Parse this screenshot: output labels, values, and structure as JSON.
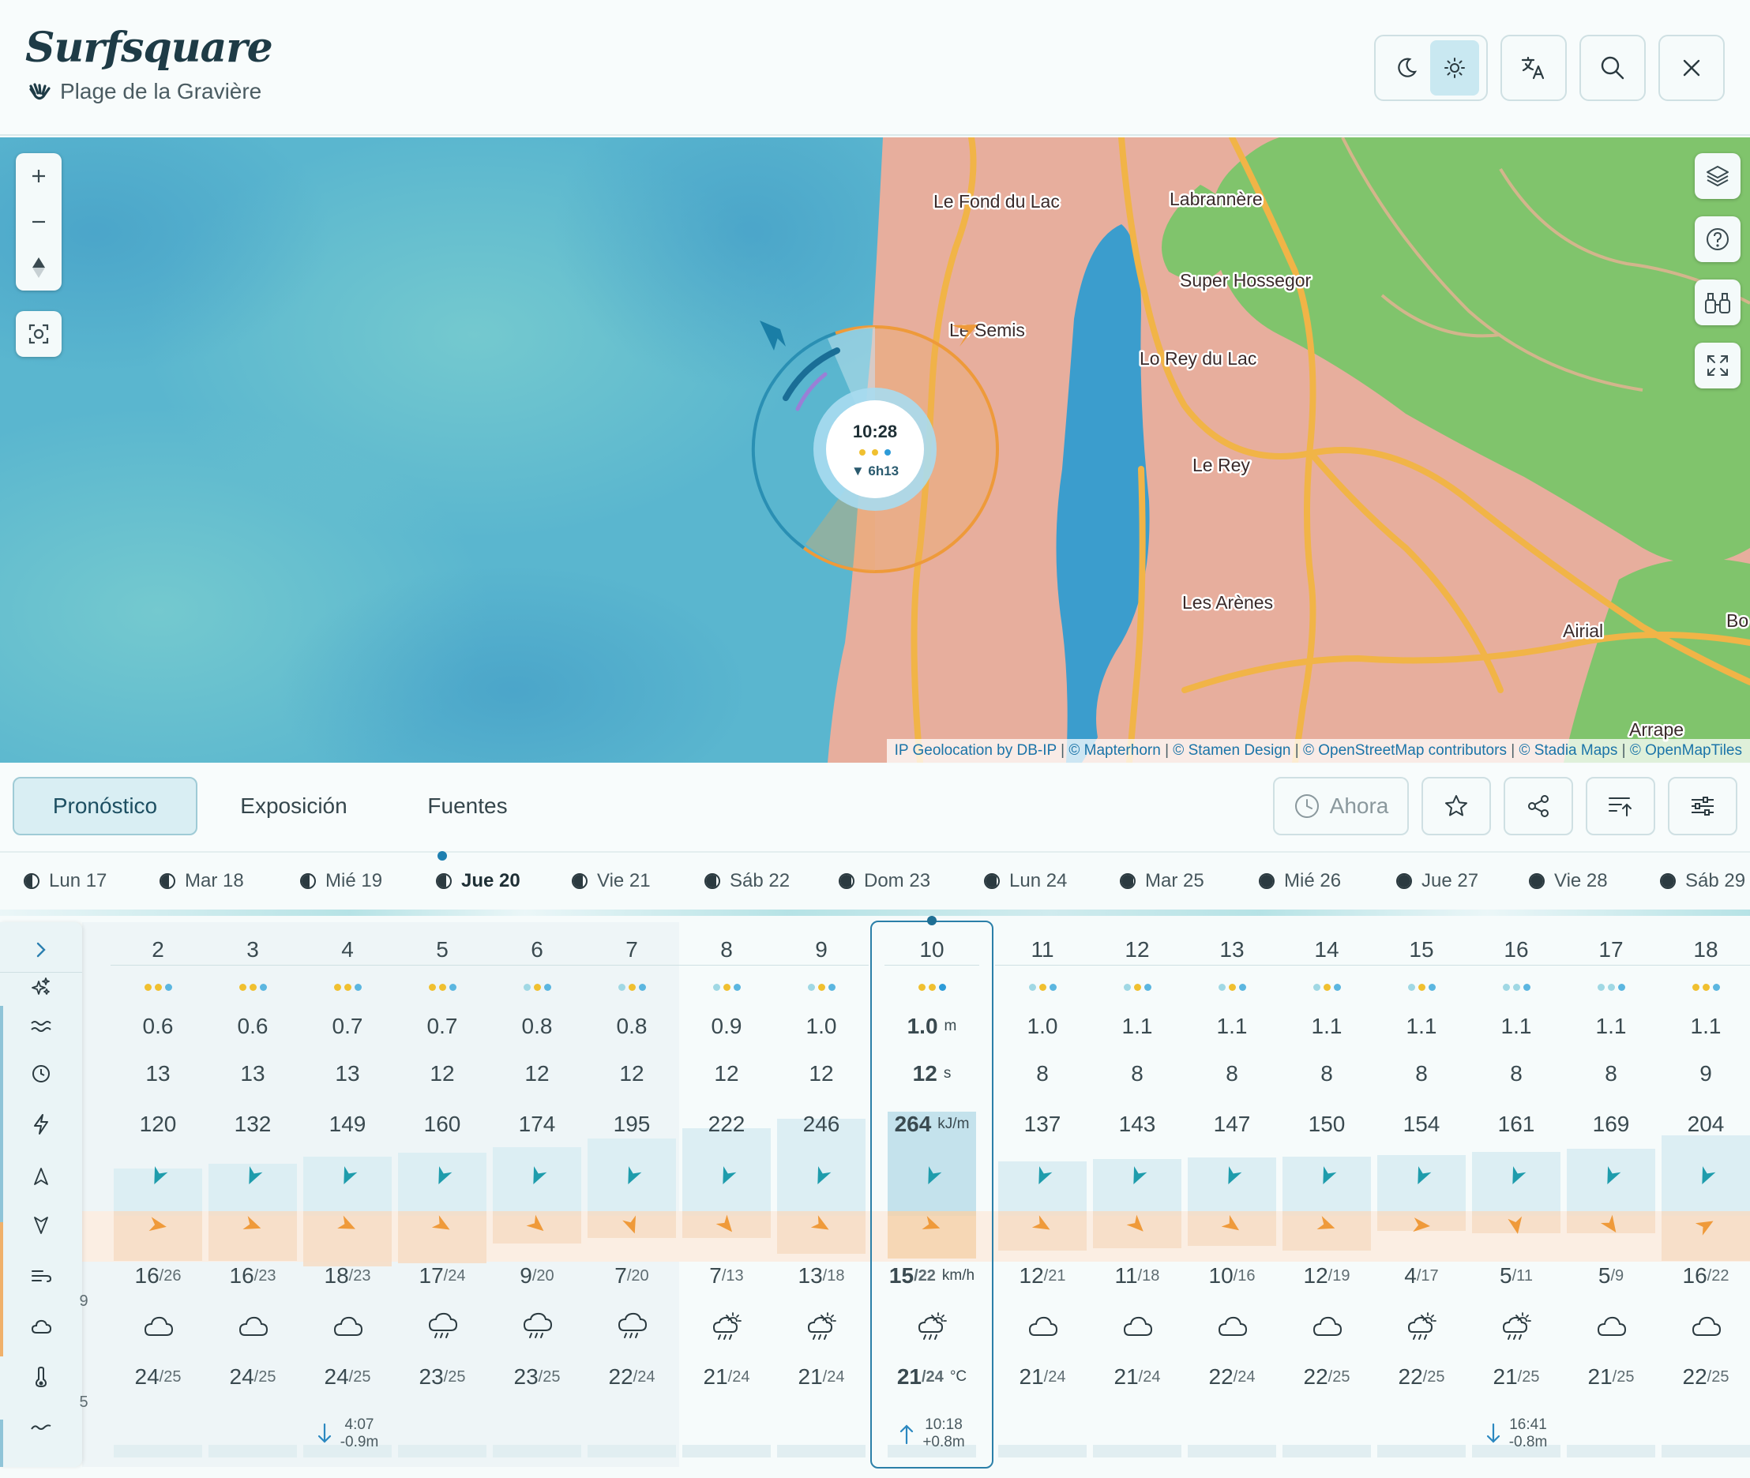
{
  "app": {
    "title": "Surfsquare",
    "place": "Plage de la Gravière"
  },
  "header": {
    "icons": [
      "moon-icon",
      "sun-icon",
      "translate-icon",
      "search-icon",
      "close-icon"
    ]
  },
  "map": {
    "labels": {
      "fond": "Le Fond du Lac",
      "labrannere": "Labrannère",
      "hossegor": "Super Hossegor",
      "semis": "Le Semis",
      "reylac": "Lo Rey du Lac",
      "rey": "Le Rey",
      "arenes": "Les Arènes",
      "airial": "Airial",
      "arrape": "Arrape",
      "bo": "Bo"
    },
    "marker": {
      "time": "10:28",
      "tide": "▼ 6h13"
    },
    "attribution": {
      "a": "IP Geolocation by DB-IP",
      "b": "© Mapterhorn",
      "c": "© Stamen Design",
      "d": "© OpenStreetMap contributors",
      "e": "© Stadia Maps",
      "f": "© OpenMapTiles",
      "sep": "|"
    },
    "colors": {
      "sea": "#5bb9d1",
      "land": "#e6ad9c",
      "forest": "#7cc26a",
      "road": "#f0b347",
      "lake": "#3c9ccf"
    }
  },
  "tabs": {
    "forecast": "Pronóstico",
    "exposure": "Exposición",
    "sources": "Fuentes",
    "now": "Ahora"
  },
  "days": [
    {
      "label": "Lun 17",
      "moon": 0.55
    },
    {
      "label": "Mar 18",
      "moon": 0.6
    },
    {
      "label": "Mié 19",
      "moon": 0.65
    },
    {
      "label": "Jue 20",
      "moon": 0.7,
      "selected": true
    },
    {
      "label": "Vie 21",
      "moon": 0.75
    },
    {
      "label": "Sáb 22",
      "moon": 0.8
    },
    {
      "label": "Dom 23",
      "moon": 0.85
    },
    {
      "label": "Lun 24",
      "moon": 0.9
    },
    {
      "label": "Mar 25",
      "moon": 0.95
    },
    {
      "label": "Mié 26",
      "moon": 0.97
    },
    {
      "label": "Jue 27",
      "moon": 1
    },
    {
      "label": "Vie 28",
      "moon": 1
    },
    {
      "label": "Sáb 29",
      "moon": 1
    }
  ],
  "units": {
    "height": "m",
    "period": "s",
    "energy": "kJ/m",
    "wind": "km/h",
    "temp": "°C"
  },
  "partial": {
    "wind": "9",
    "temp": "5"
  },
  "hours": [
    {
      "h": "2",
      "dots": [
        "#f0c030",
        "#f0c030",
        "#5bb6e0"
      ],
      "ht": "0.6",
      "p": "13",
      "e": "120",
      "wd": 205,
      "wi": 100,
      "w": "16",
      "g": "/26",
      "wx": "cloud",
      "t": "24",
      "tm": "/25"
    },
    {
      "h": "3",
      "dots": [
        "#f0c030",
        "#f0c030",
        "#5bb6e0"
      ],
      "ht": "0.6",
      "p": "13",
      "e": "132",
      "wd": 205,
      "wi": 110,
      "w": "16",
      "g": "/23",
      "wx": "cloud",
      "t": "24",
      "tm": "/25"
    },
    {
      "h": "4",
      "dots": [
        "#f0c030",
        "#f0c030",
        "#5bb6e0"
      ],
      "ht": "0.7",
      "p": "13",
      "e": "149",
      "wd": 205,
      "wi": 115,
      "w": "18",
      "g": "/23",
      "wx": "cloud",
      "t": "24",
      "tm": "/25",
      "tide": {
        "dir": "down",
        "time": "4:07",
        "h": "-0.9m"
      }
    },
    {
      "h": "5",
      "dots": [
        "#f0c030",
        "#f0c030",
        "#5bb6e0"
      ],
      "ht": "0.7",
      "p": "12",
      "e": "160",
      "wd": 205,
      "wi": 120,
      "w": "17",
      "g": "/24",
      "wx": "rain",
      "t": "23",
      "tm": "/25"
    },
    {
      "h": "6",
      "dots": [
        "#a0d8e4",
        "#f0c030",
        "#5bb6e0"
      ],
      "ht": "0.8",
      "p": "12",
      "e": "174",
      "wd": 205,
      "wi": 130,
      "w": "9",
      "g": "/20",
      "wx": "rain",
      "t": "23",
      "tm": "/25"
    },
    {
      "h": "7",
      "dots": [
        "#a0d8e4",
        "#f0c030",
        "#5bb6e0"
      ],
      "ht": "0.8",
      "p": "12",
      "e": "195",
      "wd": 205,
      "wi": 160,
      "w": "7",
      "g": "/20",
      "wx": "rain",
      "t": "22",
      "tm": "/24"
    },
    {
      "h": "8",
      "dots": [
        "#a0d8e4",
        "#f0c030",
        "#5bb6e0"
      ],
      "ht": "0.9",
      "p": "12",
      "e": "222",
      "wd": 205,
      "wi": 140,
      "w": "7",
      "g": "/13",
      "wx": "sunrain",
      "t": "21",
      "tm": "/24"
    },
    {
      "h": "9",
      "dots": [
        "#a0d8e4",
        "#f0c030",
        "#5bb6e0"
      ],
      "ht": "1.0",
      "p": "12",
      "e": "246",
      "wd": 205,
      "wi": 120,
      "w": "13",
      "g": "/18",
      "wx": "sunrain",
      "t": "21",
      "tm": "/24"
    },
    {
      "h": "10",
      "dots": [
        "#f0c030",
        "#f0c030",
        "#2d9bd8"
      ],
      "ht": "1.0",
      "p": "12",
      "e": "264",
      "wd": 205,
      "wi": 110,
      "w": "15",
      "g": "/22",
      "wx": "sunrain",
      "t": "21",
      "tm": "/24",
      "tide": {
        "dir": "up",
        "time": "10:18",
        "h": "+0.8m"
      },
      "selected": true
    },
    {
      "h": "11",
      "dots": [
        "#a0d8e4",
        "#f0c030",
        "#5bb6e0"
      ],
      "ht": "1.0",
      "p": "8",
      "e": "137",
      "wd": 205,
      "wi": 120,
      "w": "12",
      "g": "/21",
      "wx": "cloud",
      "t": "21",
      "tm": "/24"
    },
    {
      "h": "12",
      "dots": [
        "#a0d8e4",
        "#f0c030",
        "#5bb6e0"
      ],
      "ht": "1.1",
      "p": "8",
      "e": "143",
      "wd": 205,
      "wi": 135,
      "w": "11",
      "g": "/18",
      "wx": "cloud",
      "t": "21",
      "tm": "/24"
    },
    {
      "h": "13",
      "dots": [
        "#a0d8e4",
        "#f0c030",
        "#5bb6e0"
      ],
      "ht": "1.1",
      "p": "8",
      "e": "147",
      "wd": 205,
      "wi": 125,
      "w": "10",
      "g": "/16",
      "wx": "cloud",
      "t": "22",
      "tm": "/24"
    },
    {
      "h": "14",
      "dots": [
        "#a0d8e4",
        "#f0c030",
        "#5bb6e0"
      ],
      "ht": "1.1",
      "p": "8",
      "e": "150",
      "wd": 205,
      "wi": 110,
      "w": "12",
      "g": "/19",
      "wx": "cloud",
      "t": "22",
      "tm": "/25"
    },
    {
      "h": "15",
      "dots": [
        "#a0d8e4",
        "#f0c030",
        "#5bb6e0"
      ],
      "ht": "1.1",
      "p": "8",
      "e": "154",
      "wd": 205,
      "wi": 95,
      "w": "4",
      "g": "/17",
      "wx": "sunrain",
      "t": "22",
      "tm": "/25"
    },
    {
      "h": "16",
      "dots": [
        "#a0d8e4",
        "#a0d8e4",
        "#5bb6e0"
      ],
      "ht": "1.1",
      "p": "8",
      "e": "161",
      "wd": 205,
      "wi": 170,
      "w": "5",
      "g": "/11",
      "wx": "sunrain",
      "t": "21",
      "tm": "/25",
      "tide": {
        "dir": "down",
        "time": "16:41",
        "h": "-0.8m"
      }
    },
    {
      "h": "17",
      "dots": [
        "#a0d8e4",
        "#a0d8e4",
        "#5bb6e0"
      ],
      "ht": "1.1",
      "p": "8",
      "e": "169",
      "wd": 205,
      "wi": 145,
      "w": "5",
      "g": "/9",
      "wx": "cloud",
      "t": "21",
      "tm": "/25"
    },
    {
      "h": "18",
      "dots": [
        "#f0c030",
        "#f0c030",
        "#5bb6e0"
      ],
      "ht": "1.1",
      "p": "9",
      "e": "204",
      "wd": 205,
      "wi": 60,
      "w": "16",
      "g": "/22",
      "wx": "cloud",
      "t": "22",
      "tm": "/25"
    }
  ]
}
